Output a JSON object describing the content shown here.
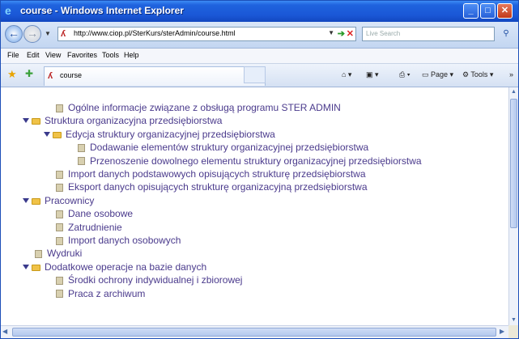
{
  "window": {
    "title": "course - Windows Internet Explorer",
    "minimize": "_",
    "maximize": "□",
    "close": "✕"
  },
  "nav": {
    "back": "←",
    "forward": "→",
    "url": "http://www.ciop.pl/SterKurs/sterAdmin/course.html",
    "search_placeholder": "Live Search"
  },
  "menubar": [
    "File",
    "Edit",
    "View",
    "Favorites",
    "Tools",
    "Help"
  ],
  "tab": {
    "label": "course"
  },
  "toolbar": {
    "page": "Page",
    "tools": "Tools"
  },
  "tree": [
    {
      "label": "Ogólne informacje związane z obsługą programu STER ADMIN",
      "level": 1,
      "type": "doc"
    },
    {
      "label": "Struktura organizacyjna przedsiębiorstwa",
      "level": 0,
      "type": "folder",
      "expanded": true
    },
    {
      "label": "Edycja struktury organizacyjnej przedsiębiorstwa",
      "level": 1,
      "type": "folder",
      "expanded": true
    },
    {
      "label": "Dodawanie elementów struktury organizacyjnej przedsiębiorstwa",
      "level": 2,
      "type": "doc"
    },
    {
      "label": "Przenoszenie dowolnego elementu struktury organizacyjnej przedsiębiorstwa",
      "level": 2,
      "type": "doc"
    },
    {
      "label": "Import danych podstawowych opisujących strukturę przedsiębiorstwa",
      "level": 1,
      "type": "doc"
    },
    {
      "label": "Eksport danych opisujących strukturę organizacyjną przedsiębiorstwa",
      "level": 1,
      "type": "doc"
    },
    {
      "label": "Pracownicy",
      "level": 0,
      "type": "folder",
      "expanded": true
    },
    {
      "label": "Dane osobowe",
      "level": 1,
      "type": "doc"
    },
    {
      "label": "Zatrudnienie",
      "level": 1,
      "type": "doc"
    },
    {
      "label": "Import  danych osobowych",
      "level": 1,
      "type": "doc"
    },
    {
      "label": "Wydruki",
      "level": 0,
      "type": "doc"
    },
    {
      "label": "Dodatkowe operacje na bazie danych",
      "level": 0,
      "type": "folder",
      "expanded": true
    },
    {
      "label": "Środki ochrony indywidualnej i zbiorowej",
      "level": 1,
      "type": "doc"
    },
    {
      "label": "Praca z archiwum",
      "level": 1,
      "type": "doc"
    }
  ],
  "colors": {
    "tree_text": "#4a3a8c",
    "titlebar": "#1f63de",
    "folder": "#f0c247",
    "doc": "#d8d0b0"
  }
}
